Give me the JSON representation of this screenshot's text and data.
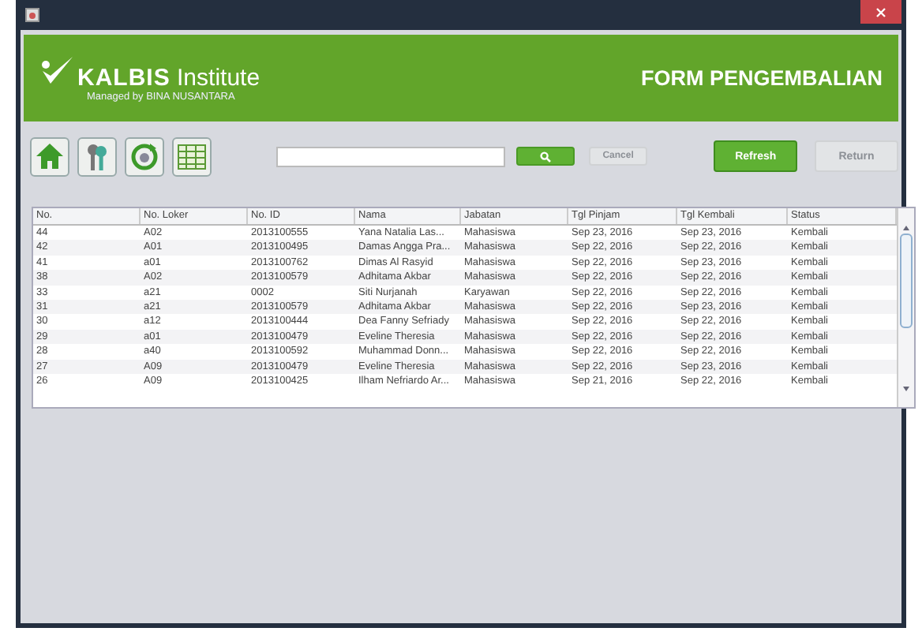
{
  "banner": {
    "brand": "KALBIS",
    "brand_suffix": "Institute",
    "tagline": "Managed by BINA NUSANTARA",
    "heading": "FORM PENGEMBALIAN"
  },
  "toolbar": {
    "cancel": {
      "label": "Cancel",
      "disabled": true
    },
    "refresh": {
      "label": "Refresh",
      "disabled": false
    },
    "return": {
      "label": "Return",
      "disabled": true
    }
  },
  "table": {
    "columns": [
      "No.",
      "No. Loker",
      "No. ID",
      "Nama",
      "Jabatan",
      "Tgl Pinjam",
      "Tgl Kembali",
      "Status"
    ],
    "rows": [
      [
        "44",
        "A02",
        "2013100555",
        "Yana Natalia Las...",
        "Mahasiswa",
        "Sep 23, 2016",
        "Sep 23, 2016",
        "Kembali"
      ],
      [
        "42",
        "A01",
        "2013100495",
        "Damas Angga Pra...",
        "Mahasiswa",
        "Sep 22, 2016",
        "Sep 22, 2016",
        "Kembali"
      ],
      [
        "41",
        "a01",
        "2013100762",
        "Dimas Al Rasyid",
        "Mahasiswa",
        "Sep 22, 2016",
        "Sep 23, 2016",
        "Kembali"
      ],
      [
        "38",
        "A02",
        "2013100579",
        "Adhitama Akbar",
        "Mahasiswa",
        "Sep 22, 2016",
        "Sep 22, 2016",
        "Kembali"
      ],
      [
        "33",
        "a21",
        "0002",
        "Siti Nurjanah",
        "Karyawan",
        "Sep 22, 2016",
        "Sep 22, 2016",
        "Kembali"
      ],
      [
        "31",
        "a21",
        "2013100579",
        "Adhitama Akbar",
        "Mahasiswa",
        "Sep 22, 2016",
        "Sep 23, 2016",
        "Kembali"
      ],
      [
        "30",
        "a12",
        "2013100444",
        "Dea Fanny Sefriady",
        "Mahasiswa",
        "Sep 22, 2016",
        "Sep 22, 2016",
        "Kembali"
      ],
      [
        "29",
        "a01",
        "2013100479",
        "Eveline Theresia",
        "Mahasiswa",
        "Sep 22, 2016",
        "Sep 22, 2016",
        "Kembali"
      ],
      [
        "28",
        "a40",
        "2013100592",
        "Muhammad Donn...",
        "Mahasiswa",
        "Sep 22, 2016",
        "Sep 22, 2016",
        "Kembali"
      ],
      [
        "27",
        "A09",
        "2013100479",
        "Eveline Theresia",
        "Mahasiswa",
        "Sep 22, 2016",
        "Sep 23, 2016",
        "Kembali"
      ],
      [
        "26",
        "A09",
        "2013100425",
        "Ilham Nefriardo Ar...",
        "Mahasiswa",
        "Sep 21, 2016",
        "Sep 22, 2016",
        "Kembali"
      ]
    ]
  }
}
